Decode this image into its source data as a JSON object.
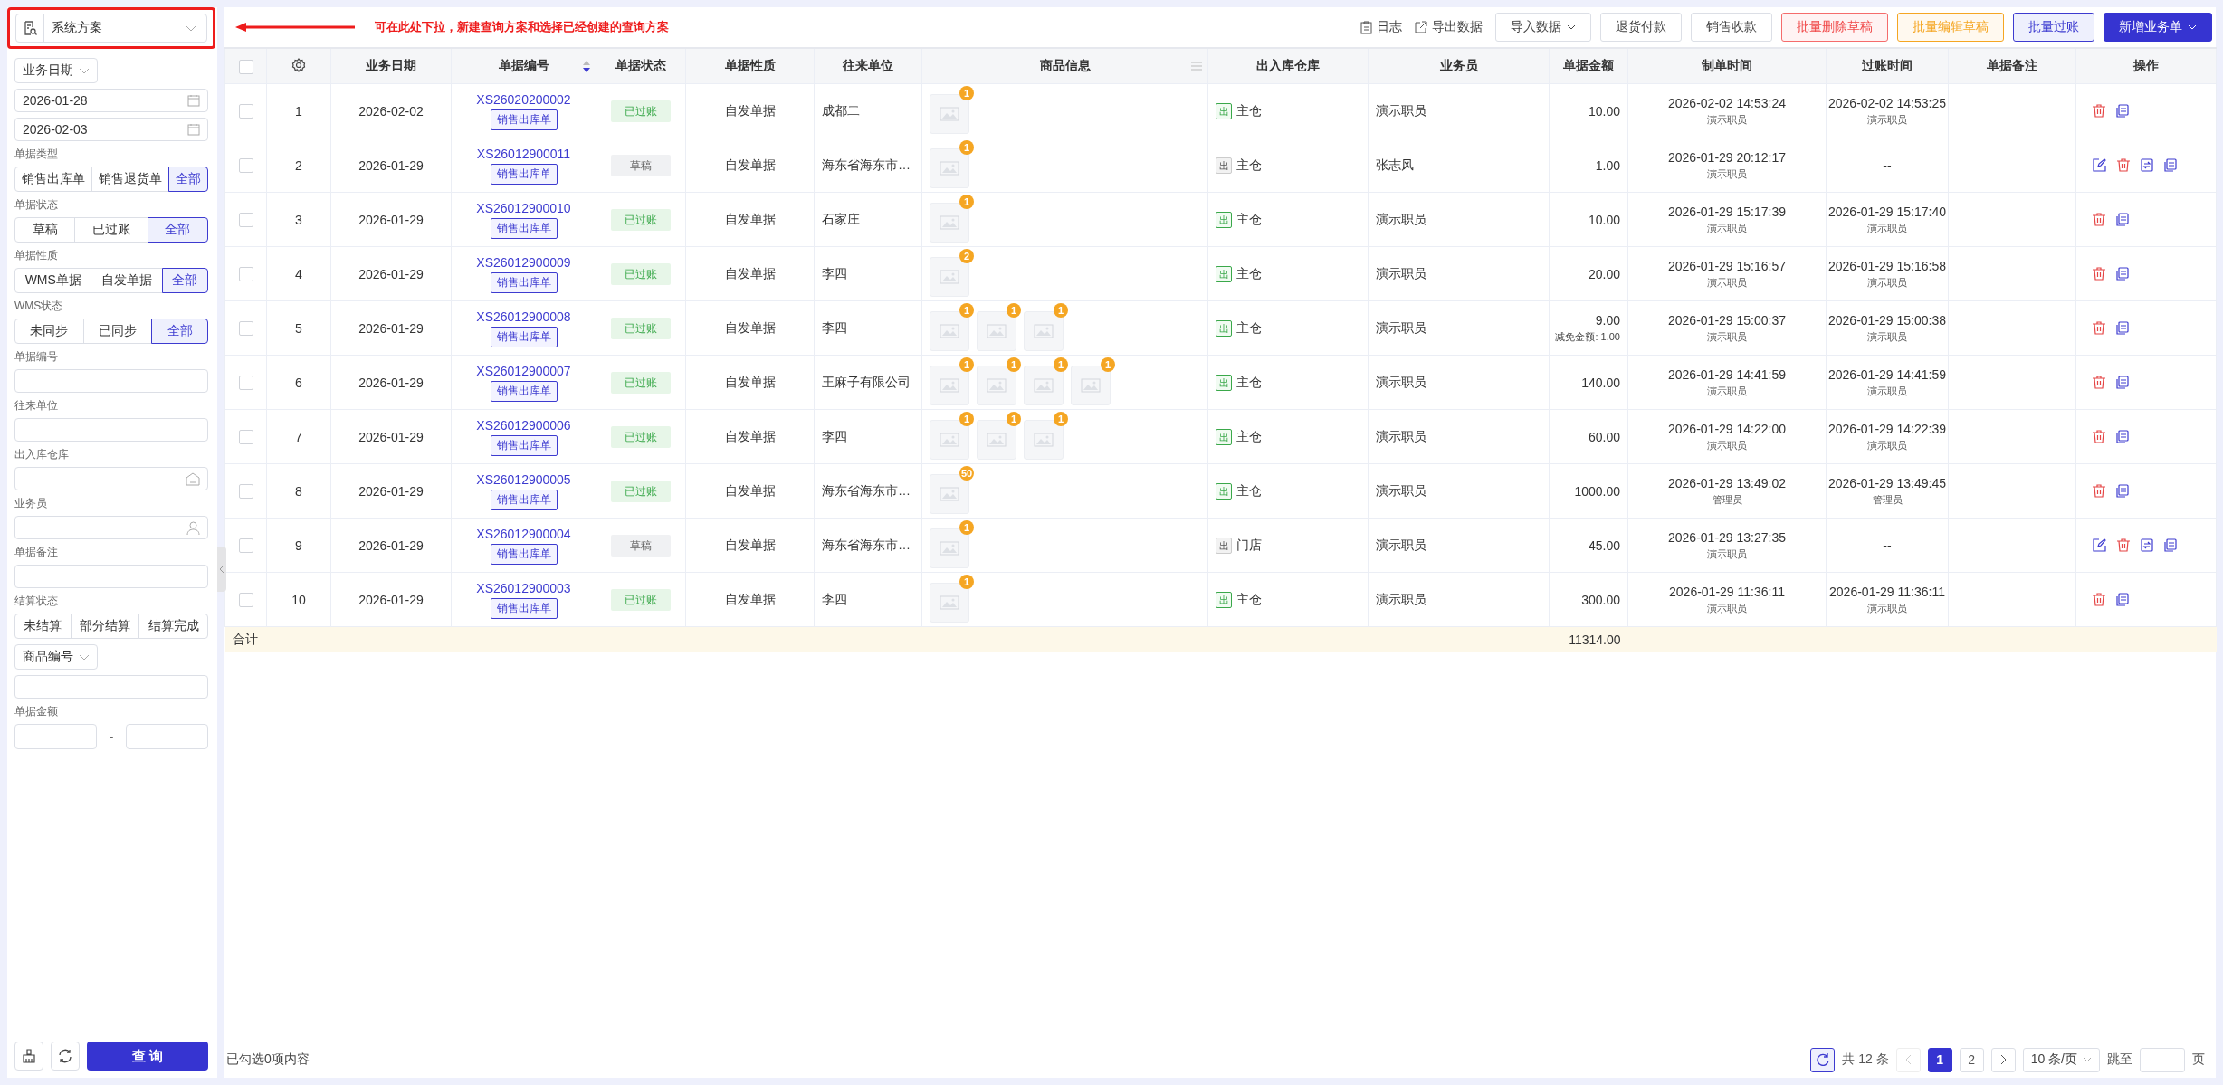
{
  "scheme_selector": {
    "value": "系统方案"
  },
  "annotation": {
    "text": "可在此处下拉，新建查询方案和选择已经创建的查询方案"
  },
  "filters": [
    {
      "kind": "dropdown",
      "value": "业务日期"
    },
    {
      "kind": "date",
      "value": "2026-01-28"
    },
    {
      "kind": "date",
      "value": "2026-02-03"
    },
    {
      "kind": "segmented",
      "label": "单据类型",
      "options": [
        {
          "label": "销售出库单",
          "selected": false
        },
        {
          "label": "销售退货单",
          "selected": false
        },
        {
          "label": "全部",
          "selected": true
        }
      ]
    },
    {
      "kind": "segmented",
      "label": "单据状态",
      "options": [
        {
          "label": "草稿",
          "selected": false
        },
        {
          "label": "已过账",
          "selected": false
        },
        {
          "label": "全部",
          "selected": true
        }
      ]
    },
    {
      "kind": "segmented",
      "label": "单据性质",
      "options": [
        {
          "label": "WMS单据",
          "selected": false
        },
        {
          "label": "自发单据",
          "selected": false
        },
        {
          "label": "全部",
          "selected": true
        }
      ]
    },
    {
      "kind": "segmented",
      "label": "WMS状态",
      "options": [
        {
          "label": "未同步",
          "selected": false
        },
        {
          "label": "已同步",
          "selected": false
        },
        {
          "label": "全部",
          "selected": true
        }
      ]
    },
    {
      "kind": "text",
      "label": "单据编号"
    },
    {
      "kind": "text",
      "label": "往来单位"
    },
    {
      "kind": "warehouse",
      "label": "出入库仓库"
    },
    {
      "kind": "person",
      "label": "业务员"
    },
    {
      "kind": "text",
      "label": "单据备注"
    },
    {
      "kind": "segmented",
      "label": "结算状态",
      "options": [
        {
          "label": "未结算",
          "selected": false
        },
        {
          "label": "部分结算",
          "selected": false
        },
        {
          "label": "结算完成",
          "selected": false
        }
      ]
    },
    {
      "kind": "dropdown",
      "value": "商品编号"
    },
    {
      "kind": "text"
    },
    {
      "kind": "range",
      "label": "单据金额",
      "separator": "-"
    }
  ],
  "query_button": "查 询",
  "toolbar": {
    "links": [
      {
        "kind": "log",
        "label": "日志"
      },
      {
        "kind": "export",
        "label": "导出数据"
      }
    ],
    "buttons": [
      {
        "label": "导入数据",
        "kind": "default",
        "dropdown": true
      },
      {
        "label": "退货付款",
        "kind": "default",
        "dropdown": false
      },
      {
        "label": "销售收款",
        "kind": "default",
        "dropdown": false
      },
      {
        "label": "批量删除草稿",
        "kind": "danger",
        "dropdown": false
      },
      {
        "label": "批量编辑草稿",
        "kind": "warning",
        "dropdown": false
      },
      {
        "label": "批量过账",
        "kind": "accent",
        "dropdown": false
      },
      {
        "label": "新增业务单",
        "kind": "primary",
        "dropdown": true
      }
    ]
  },
  "table": {
    "all_checked": false,
    "columns": [
      {
        "label": "业务日期",
        "kind": "plain"
      },
      {
        "label": "单据编号",
        "kind": "sortable"
      },
      {
        "label": "单据状态",
        "kind": "plain"
      },
      {
        "label": "单据性质",
        "kind": "plain"
      },
      {
        "label": "往来单位",
        "kind": "plain"
      },
      {
        "label": "商品信息",
        "kind": "menu"
      },
      {
        "label": "出入库仓库",
        "kind": "plain"
      },
      {
        "label": "业务员",
        "kind": "plain"
      },
      {
        "label": "单据金额",
        "kind": "plain"
      },
      {
        "label": "制单时间",
        "kind": "plain"
      },
      {
        "label": "过账时间",
        "kind": "plain"
      },
      {
        "label": "单据备注",
        "kind": "plain"
      },
      {
        "label": "操作",
        "kind": "plain"
      }
    ],
    "rows": [
      {
        "checked": false,
        "index": "1",
        "date": "2026-02-02",
        "code": "XS26020200002",
        "type_tag": "销售出库单",
        "status": {
          "label": "已过账",
          "kind": "posted"
        },
        "nature": "自发单据",
        "partner": "成都二",
        "products": [
          "1"
        ],
        "warehouse": {
          "tag": "出",
          "name": "主仓",
          "kind": "posted"
        },
        "salesperson": "演示职员",
        "amount": "10.00",
        "created": {
          "time": "2026-02-02 14:53:24",
          "by": "演示职员"
        },
        "posted": {
          "time": "2026-02-02 14:53:25",
          "by": "演示职员"
        },
        "actions": [
          {
            "kind": "delete"
          },
          {
            "kind": "copy"
          }
        ]
      },
      {
        "checked": false,
        "index": "2",
        "date": "2026-01-29",
        "code": "XS26012900011",
        "type_tag": "销售出库单",
        "status": {
          "label": "草稿",
          "kind": "draft"
        },
        "nature": "自发单据",
        "partner": "海东省海东市…",
        "products": [
          "1"
        ],
        "warehouse": {
          "tag": "出",
          "name": "主仓",
          "kind": "draft"
        },
        "salesperson": "张志风",
        "amount": "1.00",
        "created": {
          "time": "2026-01-29 20:12:17",
          "by": "演示职员"
        },
        "posted_empty": "--",
        "actions": [
          {
            "kind": "edit"
          },
          {
            "kind": "delete"
          },
          {
            "kind": "post"
          },
          {
            "kind": "copy"
          }
        ]
      },
      {
        "checked": false,
        "index": "3",
        "date": "2026-01-29",
        "code": "XS26012900010",
        "type_tag": "销售出库单",
        "status": {
          "label": "已过账",
          "kind": "posted"
        },
        "nature": "自发单据",
        "partner": "石家庄",
        "products": [
          "1"
        ],
        "warehouse": {
          "tag": "出",
          "name": "主仓",
          "kind": "posted"
        },
        "salesperson": "演示职员",
        "amount": "10.00",
        "created": {
          "time": "2026-01-29 15:17:39",
          "by": "演示职员"
        },
        "posted": {
          "time": "2026-01-29 15:17:40",
          "by": "演示职员"
        },
        "actions": [
          {
            "kind": "delete"
          },
          {
            "kind": "copy"
          }
        ]
      },
      {
        "checked": false,
        "index": "4",
        "date": "2026-01-29",
        "code": "XS26012900009",
        "type_tag": "销售出库单",
        "status": {
          "label": "已过账",
          "kind": "posted"
        },
        "nature": "自发单据",
        "partner": "李四",
        "products": [
          "2"
        ],
        "warehouse": {
          "tag": "出",
          "name": "主仓",
          "kind": "posted"
        },
        "salesperson": "演示职员",
        "amount": "20.00",
        "created": {
          "time": "2026-01-29 15:16:57",
          "by": "演示职员"
        },
        "posted": {
          "time": "2026-01-29 15:16:58",
          "by": "演示职员"
        },
        "actions": [
          {
            "kind": "delete"
          },
          {
            "kind": "copy"
          }
        ]
      },
      {
        "checked": false,
        "index": "5",
        "date": "2026-01-29",
        "code": "XS26012900008",
        "type_tag": "销售出库单",
        "status": {
          "label": "已过账",
          "kind": "posted"
        },
        "nature": "自发单据",
        "partner": "李四",
        "products": [
          "1",
          "1",
          "1"
        ],
        "warehouse": {
          "tag": "出",
          "name": "主仓",
          "kind": "posted"
        },
        "salesperson": "演示职员",
        "amount": "9.00",
        "discount": "减免金额: 1.00",
        "created": {
          "time": "2026-01-29 15:00:37",
          "by": "演示职员"
        },
        "posted": {
          "time": "2026-01-29 15:00:38",
          "by": "演示职员"
        },
        "actions": [
          {
            "kind": "delete"
          },
          {
            "kind": "copy"
          }
        ]
      },
      {
        "checked": false,
        "index": "6",
        "date": "2026-01-29",
        "code": "XS26012900007",
        "type_tag": "销售出库单",
        "status": {
          "label": "已过账",
          "kind": "posted"
        },
        "nature": "自发单据",
        "partner": "王麻子有限公司",
        "products": [
          "1",
          "1",
          "1",
          "1"
        ],
        "warehouse": {
          "tag": "出",
          "name": "主仓",
          "kind": "posted"
        },
        "salesperson": "演示职员",
        "amount": "140.00",
        "created": {
          "time": "2026-01-29 14:41:59",
          "by": "演示职员"
        },
        "posted": {
          "time": "2026-01-29 14:41:59",
          "by": "演示职员"
        },
        "actions": [
          {
            "kind": "delete"
          },
          {
            "kind": "copy"
          }
        ]
      },
      {
        "checked": false,
        "index": "7",
        "date": "2026-01-29",
        "code": "XS26012900006",
        "type_tag": "销售出库单",
        "status": {
          "label": "已过账",
          "kind": "posted"
        },
        "nature": "自发单据",
        "partner": "李四",
        "products": [
          "1",
          "1",
          "1"
        ],
        "warehouse": {
          "tag": "出",
          "name": "主仓",
          "kind": "posted"
        },
        "salesperson": "演示职员",
        "amount": "60.00",
        "created": {
          "time": "2026-01-29 14:22:00",
          "by": "演示职员"
        },
        "posted": {
          "time": "2026-01-29 14:22:39",
          "by": "演示职员"
        },
        "actions": [
          {
            "kind": "delete"
          },
          {
            "kind": "copy"
          }
        ]
      },
      {
        "checked": false,
        "index": "8",
        "date": "2026-01-29",
        "code": "XS26012900005",
        "type_tag": "销售出库单",
        "status": {
          "label": "已过账",
          "kind": "posted"
        },
        "nature": "自发单据",
        "partner": "海东省海东市…",
        "products": [
          "50"
        ],
        "warehouse": {
          "tag": "出",
          "name": "主仓",
          "kind": "posted"
        },
        "salesperson": "演示职员",
        "amount": "1000.00",
        "created": {
          "time": "2026-01-29 13:49:02",
          "by": "管理员"
        },
        "posted": {
          "time": "2026-01-29 13:49:45",
          "by": "管理员"
        },
        "actions": [
          {
            "kind": "delete"
          },
          {
            "kind": "copy"
          }
        ]
      },
      {
        "checked": false,
        "index": "9",
        "date": "2026-01-29",
        "code": "XS26012900004",
        "type_tag": "销售出库单",
        "status": {
          "label": "草稿",
          "kind": "draft"
        },
        "nature": "自发单据",
        "partner": "海东省海东市…",
        "products": [
          "1"
        ],
        "warehouse": {
          "tag": "出",
          "name": "门店",
          "kind": "draft"
        },
        "salesperson": "演示职员",
        "amount": "45.00",
        "created": {
          "time": "2026-01-29 13:27:35",
          "by": "演示职员"
        },
        "posted_empty": "--",
        "actions": [
          {
            "kind": "edit"
          },
          {
            "kind": "delete"
          },
          {
            "kind": "post"
          },
          {
            "kind": "copy"
          }
        ]
      },
      {
        "checked": false,
        "index": "10",
        "date": "2026-01-29",
        "code": "XS26012900003",
        "type_tag": "销售出库单",
        "status": {
          "label": "已过账",
          "kind": "posted"
        },
        "nature": "自发单据",
        "partner": "李四",
        "products": [
          "1"
        ],
        "warehouse": {
          "tag": "出",
          "name": "主仓",
          "kind": "posted"
        },
        "salesperson": "演示职员",
        "amount": "300.00",
        "created": {
          "time": "2026-01-29 11:36:11",
          "by": "演示职员"
        },
        "posted": {
          "time": "2026-01-29 11:36:11",
          "by": "演示职员"
        },
        "actions": [
          {
            "kind": "delete"
          },
          {
            "kind": "copy"
          }
        ]
      }
    ],
    "summary": {
      "label": "合计",
      "amount": "11314.00"
    }
  },
  "footer": {
    "selection": "已勾选0项内容",
    "total": "共 12 条",
    "prev": {
      "disabled": true
    },
    "next": {
      "disabled": false
    },
    "pages": [
      {
        "label": "1",
        "selected": true
      },
      {
        "label": "2",
        "selected": false
      }
    ],
    "page_size": "10 条/页",
    "jump_label": "跳至",
    "page_unit": "页"
  }
}
